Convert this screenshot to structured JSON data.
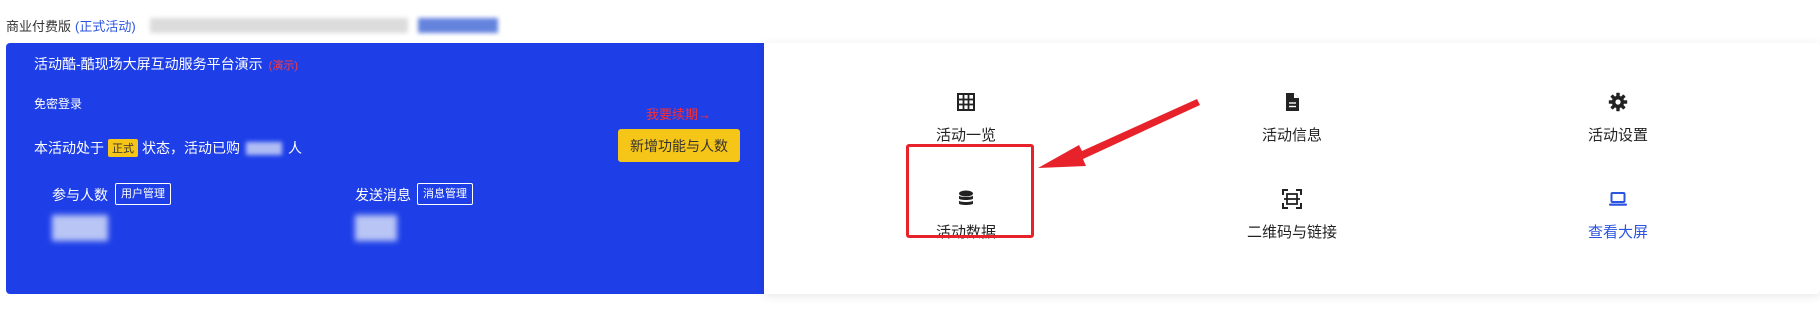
{
  "topbar": {
    "edition": "商业付费版",
    "status_link": "(正式活动)"
  },
  "panel": {
    "title": "活动酷-酷现场大屏互动服务平台演示",
    "title_tag": "(演示)",
    "login_label": "免密登录",
    "state_prefix": "本活动处于",
    "state_badge": "正式",
    "state_middle": "状态，活动已购",
    "state_suffix": "人",
    "renew_label": "我要续期→",
    "upgrade_button": "新增功能与人数",
    "stats": [
      {
        "label": "参与人数",
        "button": "用户管理"
      },
      {
        "label": "发送消息",
        "button": "消息管理"
      }
    ]
  },
  "actions": [
    {
      "label": "活动一览",
      "icon": "table-icon"
    },
    {
      "label": "活动信息",
      "icon": "document-icon"
    },
    {
      "label": "活动设置",
      "icon": "gear-icon"
    },
    {
      "label": "活动数据",
      "icon": "database-icon"
    },
    {
      "label": "二维码与链接",
      "icon": "qrcode-scan-icon"
    },
    {
      "label": "查看大屏",
      "icon": "laptop-icon"
    }
  ],
  "colors": {
    "primary": "#1e3fe8",
    "accent_yellow": "#f5c518",
    "highlight_red": "#e8222a",
    "link_blue": "#2b55e0"
  }
}
